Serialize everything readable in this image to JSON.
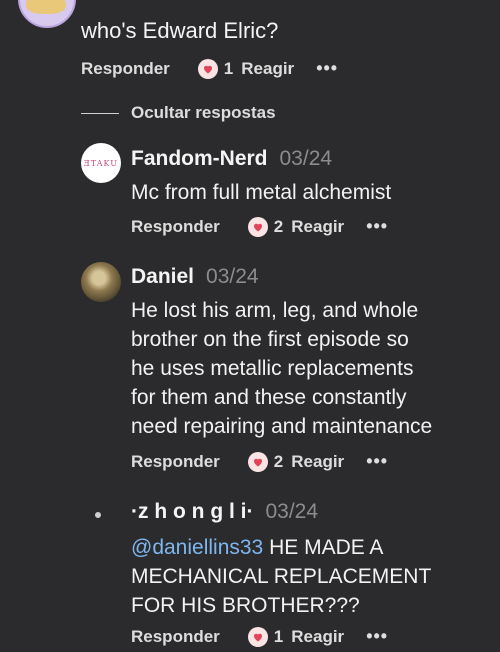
{
  "comments": {
    "top": {
      "text": "who's Edward Elric?",
      "reply_label": "Responder",
      "reaction_count": "1",
      "react_label": "Reagir",
      "more": "•••"
    },
    "hide_replies_label": "Ocultar respostas",
    "replies": [
      {
        "author": "Fandom-Nerd",
        "date": "03/24",
        "avatar_text": "ƎTAKU",
        "lines": [
          "Mc from full metal alchemist"
        ],
        "reply_label": "Responder",
        "reaction_count": "2",
        "react_label": "Reagir",
        "more": "•••"
      },
      {
        "author": "Daniel",
        "date": "03/24",
        "lines": [
          "He lost his arm, leg, and whole",
          "brother on the first episode so",
          "he uses metallic replacements",
          "for them and these constantly",
          "need repairing and maintenance"
        ],
        "reply_label": "Responder",
        "reaction_count": "2",
        "react_label": "Reagir",
        "more": "•••"
      },
      {
        "author": "·z h o n g l i·",
        "date": "03/24",
        "mention": "@daniellins33",
        "lines": [
          " HE MADE A",
          "MECHANICAL REPLACEMENT",
          "FOR HIS BROTHER???"
        ],
        "reply_label": "Responder",
        "reaction_count": "1",
        "react_label": "Reagir",
        "more": "•••"
      }
    ]
  },
  "colors": {
    "background": "#2b2b2d",
    "mention": "#7eb7f0",
    "date": "#8c8c8c",
    "heart": "#e0455b"
  },
  "icons": {
    "reaction": "heart-icon",
    "more": "more-options-icon"
  }
}
